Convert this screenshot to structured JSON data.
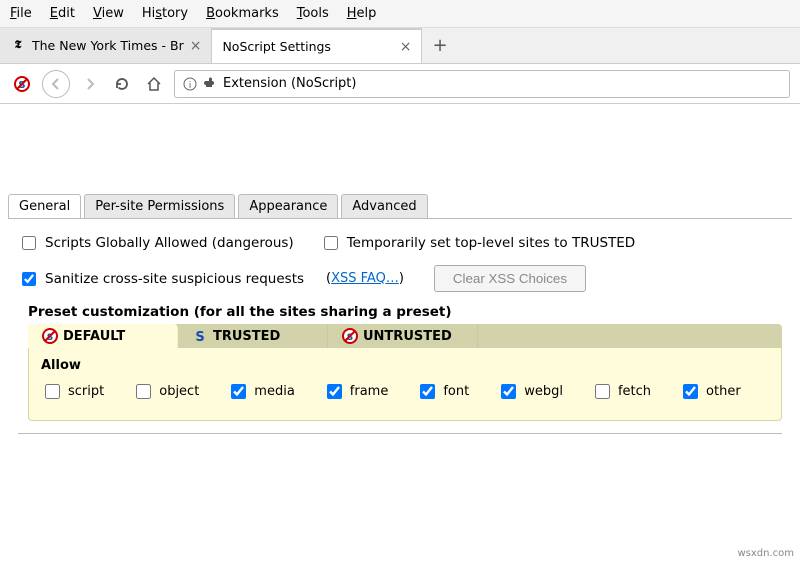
{
  "menubar": {
    "file": "File",
    "edit": "Edit",
    "view": "View",
    "history": "History",
    "bookmarks": "Bookmarks",
    "tools": "Tools",
    "help": "Help"
  },
  "tabs": [
    {
      "label": "The New York Times - Br",
      "active": false
    },
    {
      "label": "NoScript Settings",
      "active": true
    }
  ],
  "urlbar": {
    "text": "Extension (NoScript)"
  },
  "settings_tabs": {
    "general": "General",
    "per_site": "Per-site Permissions",
    "appearance": "Appearance",
    "advanced": "Advanced"
  },
  "options": {
    "scripts_global": {
      "label": "Scripts Globally Allowed (dangerous)",
      "checked": false
    },
    "temp_trusted": {
      "label": "Temporarily set top-level sites to TRUSTED",
      "checked": false
    },
    "sanitize": {
      "label": "Sanitize cross-site suspicious requests",
      "checked": true
    },
    "xss_faq": "XSS FAQ…",
    "clear_xss": "Clear XSS Choices"
  },
  "preset": {
    "heading": "Preset customization (for all the sites sharing a preset)",
    "tabs": {
      "default": "DEFAULT",
      "trusted": "TRUSTED",
      "untrusted": "UNTRUSTED"
    },
    "allow_label": "Allow",
    "permissions": [
      {
        "key": "script",
        "label": "script",
        "checked": false
      },
      {
        "key": "object",
        "label": "object",
        "checked": false
      },
      {
        "key": "media",
        "label": "media",
        "checked": true
      },
      {
        "key": "frame",
        "label": "frame",
        "checked": true
      },
      {
        "key": "font",
        "label": "font",
        "checked": true
      },
      {
        "key": "webgl",
        "label": "webgl",
        "checked": true
      },
      {
        "key": "fetch",
        "label": "fetch",
        "checked": false
      },
      {
        "key": "other",
        "label": "other",
        "checked": true
      }
    ]
  },
  "watermark": "wsxdn.com"
}
